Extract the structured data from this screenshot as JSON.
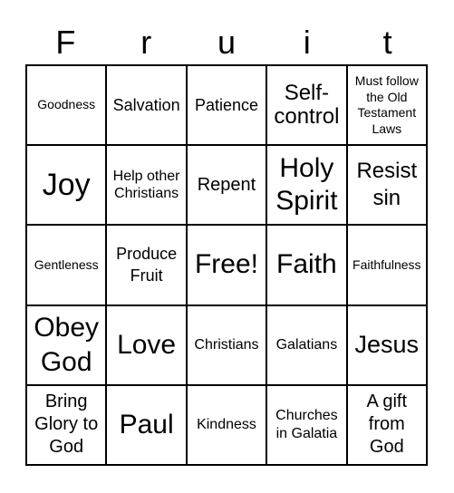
{
  "title_letters": [
    "F",
    "r",
    "u",
    "i",
    "t"
  ],
  "cells": [
    [
      "Goodness",
      "Salvation",
      "Patience",
      "Self-control",
      "Must follow the Old Testament Laws"
    ],
    [
      "Joy",
      "Help other Christians",
      "Repent",
      "Holy Spirit",
      "Resist sin"
    ],
    [
      "Gentleness",
      "Produce Fruit",
      "Free!",
      "Faith",
      "Faithfulness"
    ],
    [
      "Obey God",
      "Love",
      "Christians",
      "Galatians",
      "Jesus"
    ],
    [
      "Bring Glory to God",
      "Paul",
      "Kindness",
      "Churches in Galatia",
      "A gift from God"
    ]
  ],
  "free_space_label": "Free!"
}
